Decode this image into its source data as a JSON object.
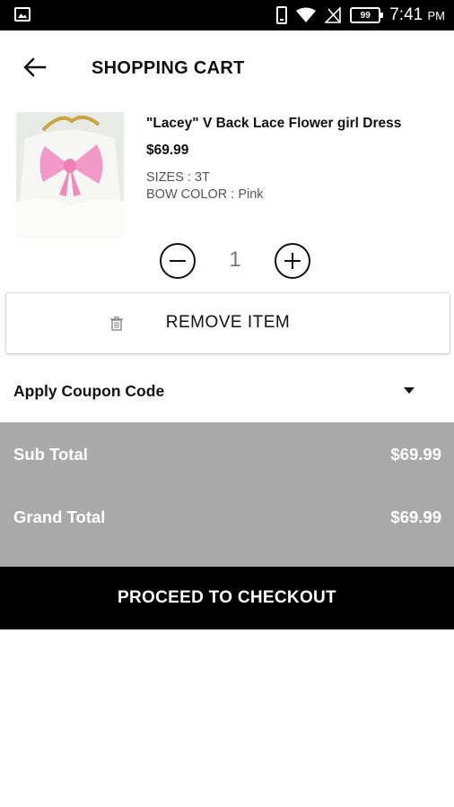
{
  "status_bar": {
    "battery": "99",
    "time": "7:41",
    "ampm": "PM"
  },
  "header": {
    "title": "SHOPPING CART",
    "back_icon": "arrow-left-icon"
  },
  "cart_item": {
    "name": "\"Lacey\" V Back Lace Flower girl Dress",
    "price": "$69.99",
    "size": "SIZES : 3T",
    "bow_color": "BOW COLOR : Pink",
    "quantity": "1",
    "remove_label": "REMOVE ITEM"
  },
  "coupon": {
    "label": "Apply Coupon Code"
  },
  "totals": {
    "sub_total_label": "Sub Total",
    "sub_total_value": "$69.99",
    "grand_total_label": "Grand Total",
    "grand_total_value": "$69.99"
  },
  "checkout": {
    "label": "PROCEED TO CHECKOUT"
  },
  "colors": {
    "totals_background": "#a9a9a9",
    "checkout_background": "#000000",
    "bow_pink": "#f29ac7"
  }
}
